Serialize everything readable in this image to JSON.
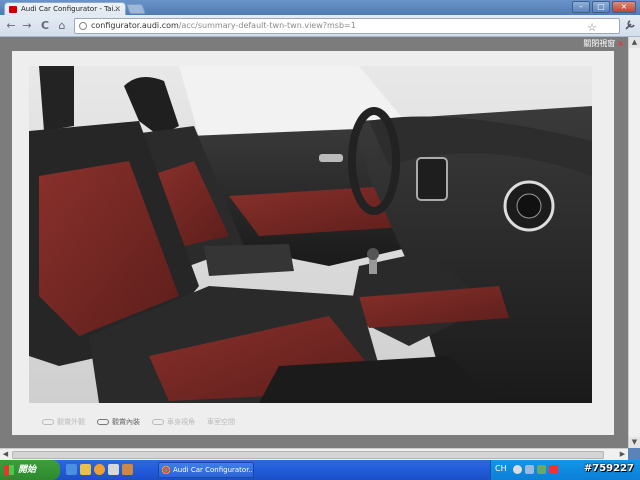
{
  "browser": {
    "tab_title": "Audi Car Configurator - Tai...",
    "tab_close": "×",
    "url_host": "configurator.audi.com",
    "url_path": "/acc/summary-default-twn-twn.view?msb=1",
    "nav": {
      "back": "←",
      "forward": "→",
      "reload": "C",
      "home": "⌂"
    },
    "star": "☆",
    "wrench": "🔧",
    "window_buttons": {
      "minimize": "–",
      "maximize": "□",
      "close": "×"
    }
  },
  "page": {
    "close_window_label": "關閉視窗",
    "close_x": "×",
    "options": [
      {
        "label": "觀賞外觀",
        "active": false
      },
      {
        "label": "觀賞內裝",
        "active": true
      },
      {
        "label": "車身視角",
        "active": false
      },
      {
        "label": "車室空間",
        "active": false
      }
    ]
  },
  "taskbar": {
    "start_label": "開始",
    "task_item": "Audi Car Configurator...",
    "lang": "CH",
    "watermark": "#759227"
  },
  "colors": {
    "leather_red": "#7b2a26",
    "seat_black": "#2a2a2a",
    "taskbar_blue": "#245edb",
    "start_green": "#3c9d3c"
  }
}
